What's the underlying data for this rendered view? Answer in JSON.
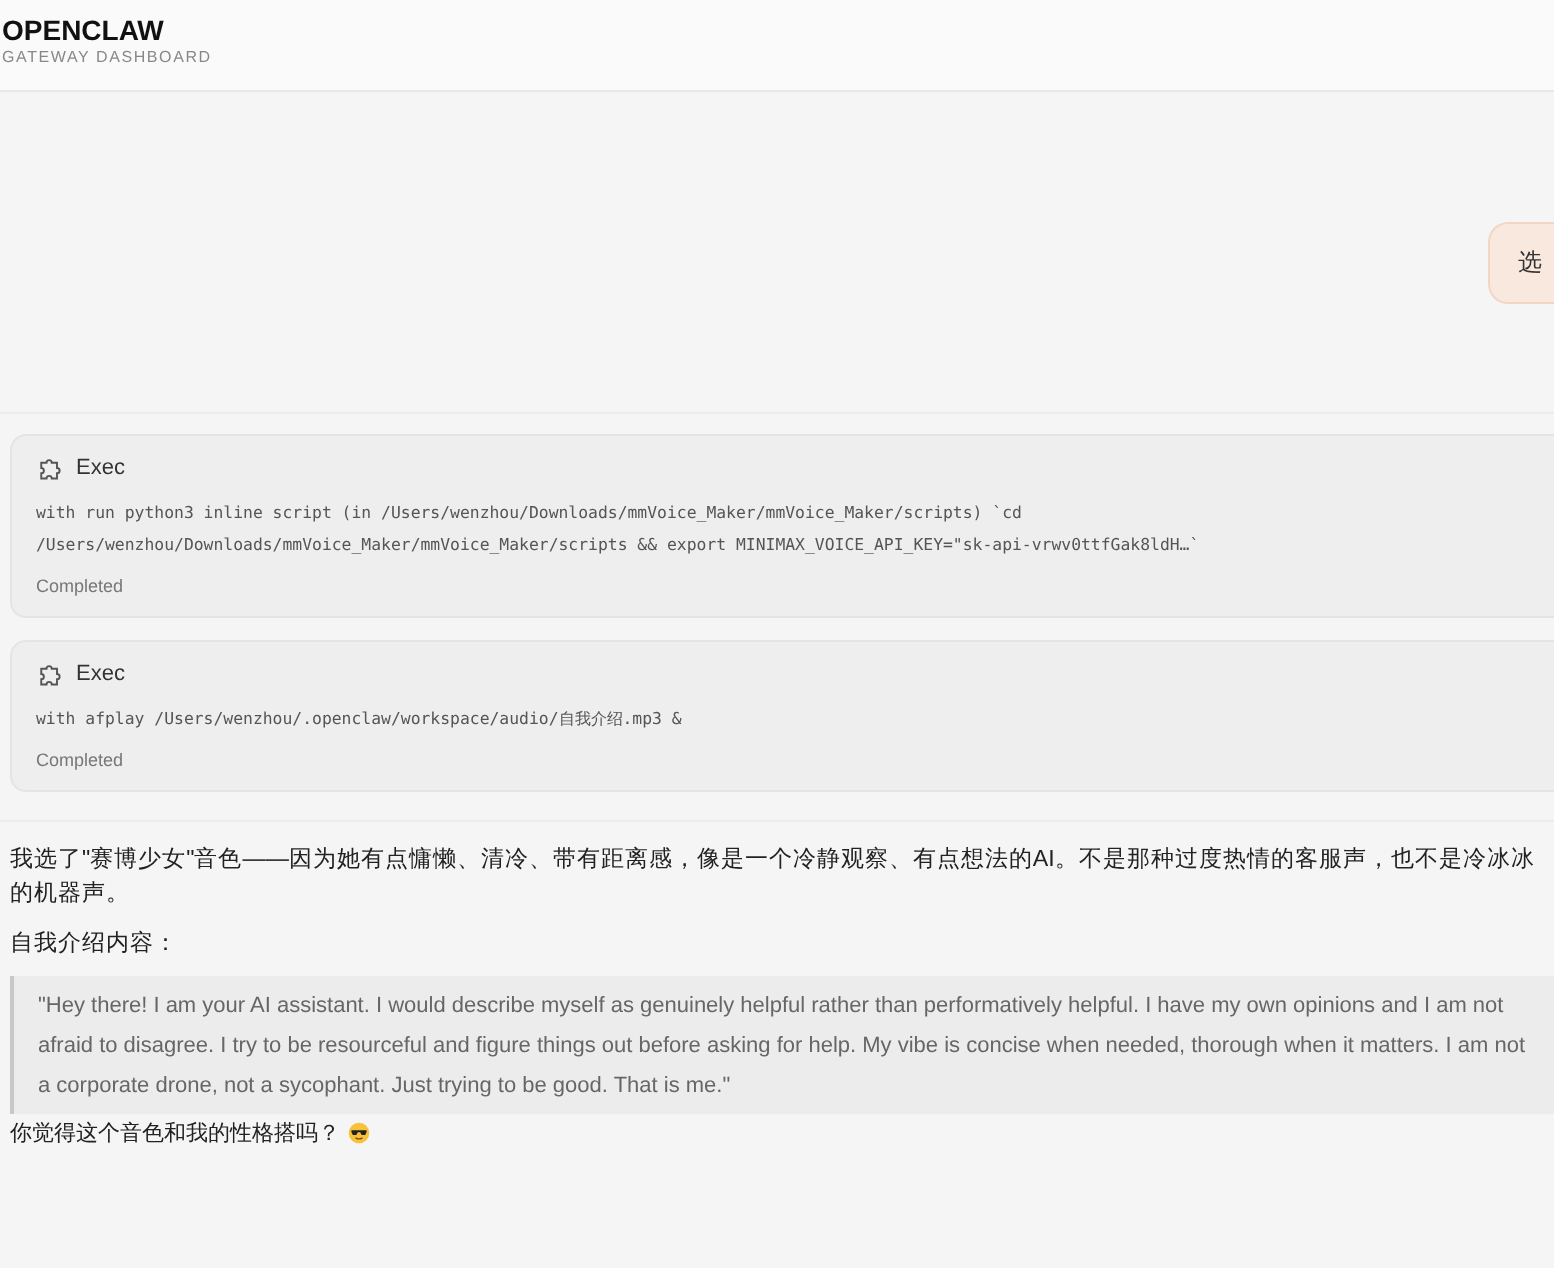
{
  "header": {
    "title": "OPENCLAW",
    "subtitle": "GATEWAY DASHBOARD"
  },
  "user_message": {
    "text": "选"
  },
  "tool_cards": [
    {
      "tool": "Exec",
      "command": "with run python3 inline script (in /Users/wenzhou/Downloads/mmVoice_Maker/mmVoice_Maker/scripts) `cd /Users/wenzhou/Downloads/mmVoice_Maker/mmVoice_Maker/scripts && export MINIMAX_VOICE_API_KEY=\"sk-api-vrwv0ttfGak8ldH…`",
      "status": "Completed"
    },
    {
      "tool": "Exec",
      "command": "with afplay /Users/wenzhou/.openclaw/workspace/audio/自我介绍.mp3 &",
      "status": "Completed"
    }
  ],
  "assistant_message": {
    "paragraphs": [
      "我选了\"赛博少女\"音色——因为她有点慵懒、清冷、带有距离感，像是一个冷静观察、有点想法的AI。不是那种过度热情的客服声，也不是冷冰冰的机器声。",
      "自我介绍内容："
    ],
    "quote": "\"Hey there! I am your AI assistant. I would describe myself as genuinely helpful rather than performatively helpful. I have my own opinions and I am not afraid to disagree. I try to be resourceful and figure things out before asking for help. My vibe is concise when needed, thorough when it matters. I am not a corporate drone, not a sycophant. Just trying to be good. That is me.\"",
    "closing": "你觉得这个音色和我的性格搭吗？"
  }
}
